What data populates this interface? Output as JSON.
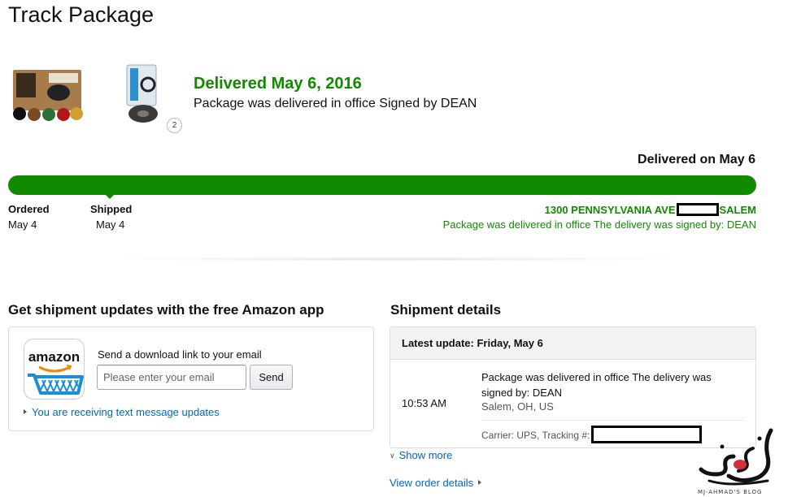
{
  "page": {
    "title": "Track Package"
  },
  "items": {
    "quantity_badge": "2"
  },
  "status": {
    "heading": "Delivered May 6, 2016",
    "subtext": "Package was delivered in office Signed by DEAN",
    "delivered_on": "Delivered on May 6",
    "progress": 1.0,
    "accent_color": "#118a00"
  },
  "steps": [
    {
      "label": "Ordered",
      "date": "May 4"
    },
    {
      "label": "Shipped",
      "date": "May 4"
    }
  ],
  "destination": {
    "address_part1": "1300 PENNSYLVANIA AVE",
    "address_part2": "SALEM",
    "note": "Package was delivered in office The delivery was signed by: DEAN"
  },
  "app_promo": {
    "title": "Get shipment updates with the free Amazon app",
    "logo_word": "amazon",
    "prompt": "Send a download link to your email",
    "email_placeholder": "Please enter your email",
    "send_label": "Send",
    "sms_link": "You are receiving text message updates"
  },
  "shipment": {
    "title": "Shipment details",
    "latest_update": "Latest update: Friday, May 6",
    "event_time": "10:53 AM",
    "event_description": "Package was delivered in office The delivery was signed by: DEAN",
    "event_location": "Salem, OH, US",
    "carrier_label": "Carrier: UPS, Tracking #:"
  },
  "links": {
    "show_more": "Show more",
    "view_order_details": "View order details"
  },
  "watermark": {
    "text": "MJ-AHMAD'S BLOG"
  }
}
